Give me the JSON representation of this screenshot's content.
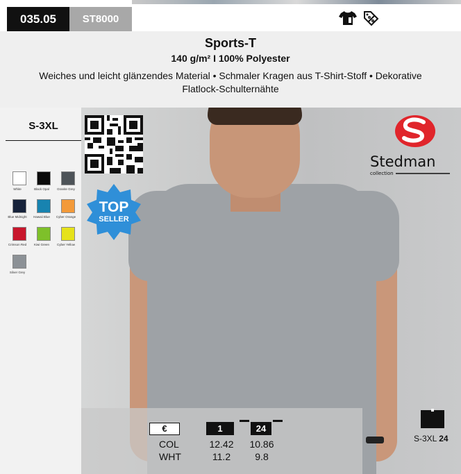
{
  "header": {
    "code": "035.05",
    "sku": "ST8000",
    "icons": [
      "tshirt-icon",
      "tag-percent-icon"
    ]
  },
  "product": {
    "title": "Sports-T",
    "subtitle": "140 g/m² I 100% Polyester",
    "description": "Weiches und leicht glänzendes Material • Schmaler Kragen aus T-Shirt-Stoff • Dekorative Flatlock-Schulternähte"
  },
  "sizes": "S-3XL",
  "colors": [
    {
      "name": "White",
      "hex": "#ffffff"
    },
    {
      "name": "Black Opal",
      "hex": "#0b0b0b"
    },
    {
      "name": "Granite Grey",
      "hex": "#4d5358"
    },
    {
      "name": "Blue Midnight",
      "hex": "#16223a"
    },
    {
      "name": "Hawaii Blue",
      "hex": "#1883b0"
    },
    {
      "name": "Cyber Orange",
      "hex": "#f39a3a"
    },
    {
      "name": "Crimson Red",
      "hex": "#c8162c"
    },
    {
      "name": "Kiwi Green",
      "hex": "#7ec02a"
    },
    {
      "name": "Cyber Yellow",
      "hex": "#e6e21a"
    },
    {
      "name": "Silver Grey",
      "hex": "#8c9196"
    }
  ],
  "badge": {
    "line1": "TOP",
    "line2": "SELLER",
    "color": "#2f8fd8"
  },
  "brand": {
    "name": "Stedman",
    "tagline": "collection",
    "color": "#e0252b"
  },
  "pricing": {
    "currency": "€",
    "qty_a": "1",
    "qty_b": "24",
    "rows": [
      {
        "label": "COL",
        "price_a": "12.42",
        "price_b": "10.86"
      },
      {
        "label": "WHT",
        "price_a": "11.2",
        "price_b": "9.8"
      }
    ]
  },
  "carton": {
    "sizes": "S-3XL",
    "count": "24"
  }
}
